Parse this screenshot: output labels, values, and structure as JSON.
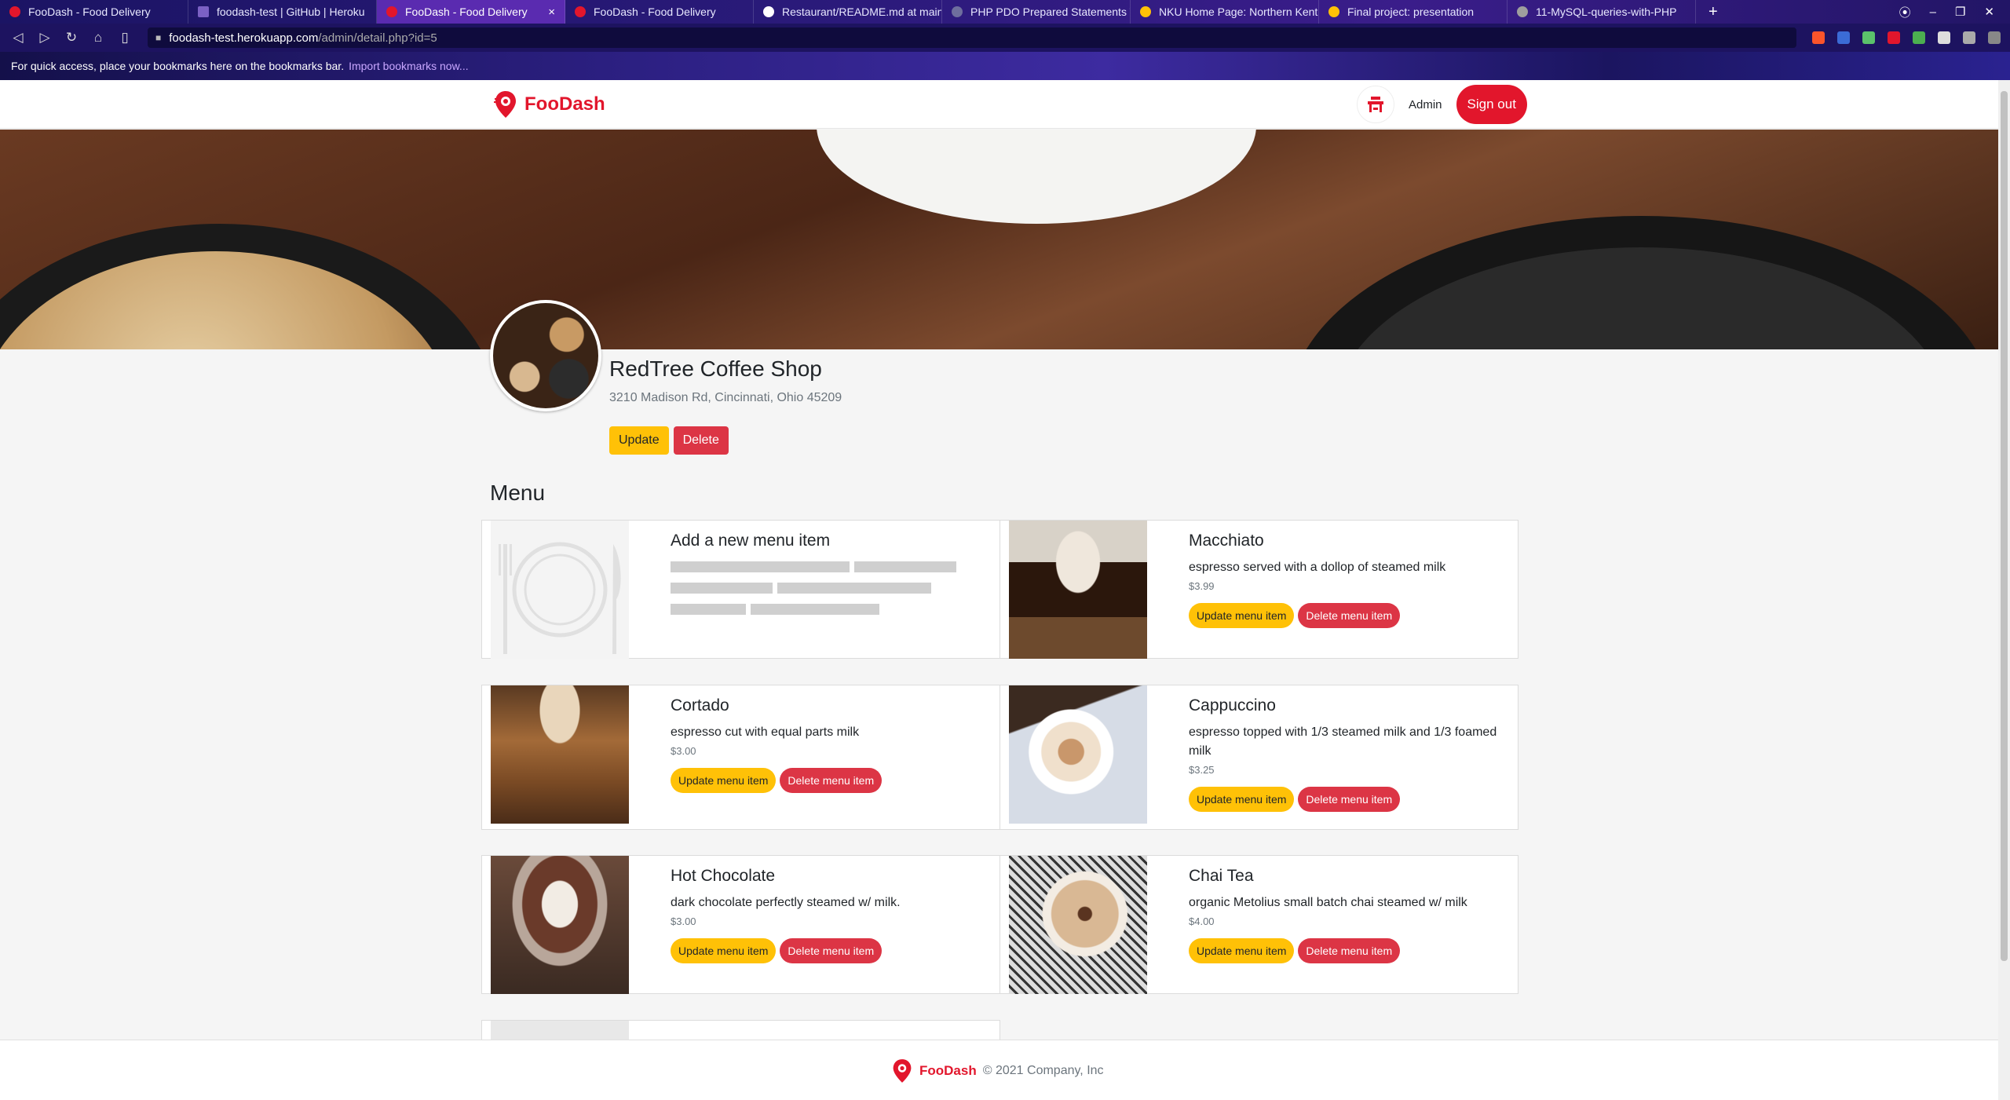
{
  "browser": {
    "tabs": [
      {
        "title": "FooDash - Food Delivery",
        "color": "#e2162c"
      },
      {
        "title": "foodash-test | GitHub | Heroku",
        "color": "#7b61c4"
      },
      {
        "title": "FooDash - Food Delivery",
        "color": "#e2162c",
        "active": true
      },
      {
        "title": "FooDash - Food Delivery",
        "color": "#e2162c"
      },
      {
        "title": "Restaurant/README.md at main",
        "color": "#ffffff"
      },
      {
        "title": "PHP PDO Prepared Statements Tu",
        "color": "#6e6e9e"
      },
      {
        "title": "NKU Home Page: Northern Kentu",
        "color": "#ffc107"
      },
      {
        "title": "Final project: presentation",
        "color": "#ffc107"
      },
      {
        "title": "11-MySQL-queries-with-PHP",
        "color": "#9e9e9e"
      }
    ],
    "tab_close": "×",
    "new_tab": "+",
    "url_host": "foodash-test.herokuapp.com",
    "url_path": "/admin/detail.php?id=5",
    "bookmarks_text": "For quick access, place your bookmarks here on the bookmarks bar.",
    "bookmarks_link": "Import bookmarks now..."
  },
  "header": {
    "brand": "FooDash",
    "admin_label": "Admin",
    "signout_label": "Sign out",
    "brand_color": "#e2162c"
  },
  "restaurant": {
    "name": "RedTree Coffee Shop",
    "address": "3210 Madison Rd, Cincinnati, Ohio 45209",
    "update_label": "Update",
    "delete_label": "Delete"
  },
  "menu": {
    "title": "Menu",
    "add_item_title": "Add a new menu item",
    "update_item_label": "Update menu item",
    "delete_item_label": "Delete menu item",
    "items": [
      {
        "name": "Macchiato",
        "description": "espresso served with a dollop of steamed milk",
        "price": "$3.99"
      },
      {
        "name": "Cortado",
        "description": "espresso cut with equal parts milk",
        "price": "$3.00"
      },
      {
        "name": "Cappuccino",
        "description": "espresso topped with 1/3 steamed milk and 1/3 foamed milk",
        "price": "$3.25"
      },
      {
        "name": "Hot Chocolate",
        "description": "dark chocolate perfectly steamed w/ milk.",
        "price": "$3.00"
      },
      {
        "name": "Chai Tea",
        "description": "organic Metolius small batch chai steamed w/ milk",
        "price": "$4.00"
      }
    ]
  },
  "footer": {
    "brand": "FooDash",
    "copyright": "© 2021 Company, Inc"
  }
}
